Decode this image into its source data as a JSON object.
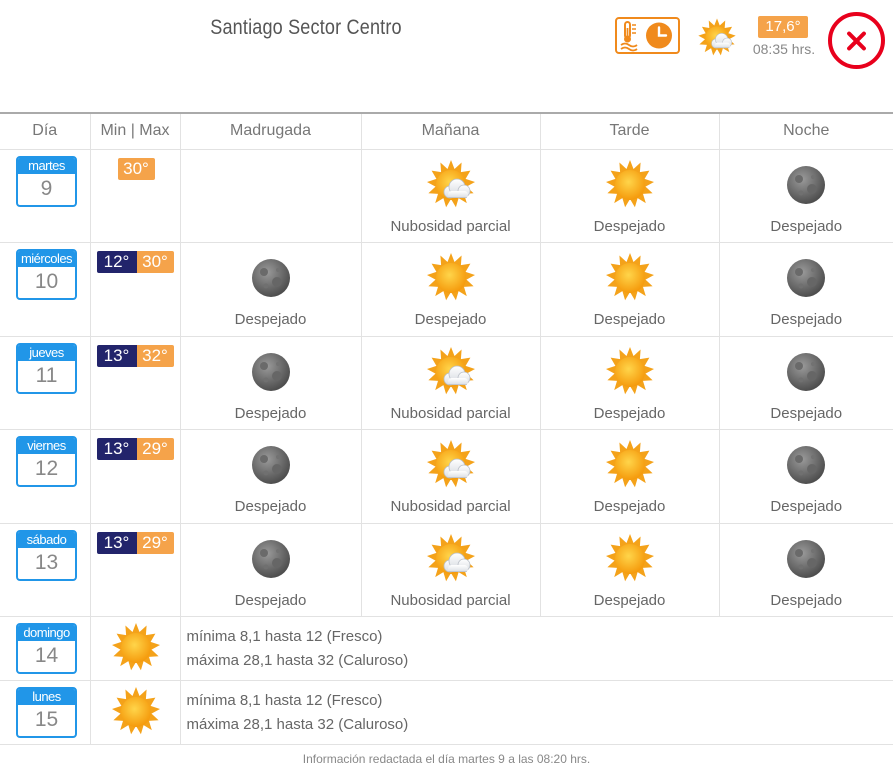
{
  "header": {
    "title": "Santiago Sector Centro",
    "current_temp": "17,6°",
    "current_time": "08:35 hrs.",
    "temp_clock_icon": "thermometer-clock-icon",
    "weather_icon": "partly-cloudy-icon",
    "close_icon": "close-icon"
  },
  "table": {
    "columns": [
      "Día",
      "Min | Max",
      "Madrugada",
      "Mañana",
      "Tarde",
      "Noche"
    ],
    "days": [
      {
        "name": "martes",
        "num": "9",
        "min": "",
        "max": "30°",
        "conds": [
          null,
          {
            "icon": "partly-cloudy-icon",
            "label": "Nubosidad parcial"
          },
          {
            "icon": "sun-icon",
            "label": "Despejado"
          },
          {
            "icon": "moon-icon",
            "label": "Despejado"
          }
        ]
      },
      {
        "name": "miércoles",
        "num": "10",
        "min": "12°",
        "max": "30°",
        "conds": [
          {
            "icon": "moon-icon",
            "label": "Despejado"
          },
          {
            "icon": "sun-icon",
            "label": "Despejado"
          },
          {
            "icon": "sun-icon",
            "label": "Despejado"
          },
          {
            "icon": "moon-icon",
            "label": "Despejado"
          }
        ]
      },
      {
        "name": "jueves",
        "num": "11",
        "min": "13°",
        "max": "32°",
        "conds": [
          {
            "icon": "moon-icon",
            "label": "Despejado"
          },
          {
            "icon": "partly-cloudy-icon",
            "label": "Nubosidad parcial"
          },
          {
            "icon": "sun-icon",
            "label": "Despejado"
          },
          {
            "icon": "moon-icon",
            "label": "Despejado"
          }
        ]
      },
      {
        "name": "viernes",
        "num": "12",
        "min": "13°",
        "max": "29°",
        "conds": [
          {
            "icon": "moon-icon",
            "label": "Despejado"
          },
          {
            "icon": "partly-cloudy-icon",
            "label": "Nubosidad parcial"
          },
          {
            "icon": "sun-icon",
            "label": "Despejado"
          },
          {
            "icon": "moon-icon",
            "label": "Despejado"
          }
        ]
      },
      {
        "name": "sábado",
        "num": "13",
        "min": "13°",
        "max": "29°",
        "conds": [
          {
            "icon": "moon-icon",
            "label": "Despejado"
          },
          {
            "icon": "partly-cloudy-icon",
            "label": "Nubosidad parcial"
          },
          {
            "icon": "sun-icon",
            "label": "Despejado"
          },
          {
            "icon": "moon-icon",
            "label": "Despejado"
          }
        ]
      }
    ],
    "summary_days": [
      {
        "name": "domingo",
        "num": "14",
        "icon": "sun-icon",
        "line1": "mínima 8,1 hasta 12 (Fresco)",
        "line2": "máxima 28,1 hasta 32 (Caluroso)"
      },
      {
        "name": "lunes",
        "num": "15",
        "icon": "sun-icon",
        "line1": "mínima 8,1 hasta 12 (Fresco)",
        "line2": "máxima 28,1 hasta 32 (Caluroso)"
      }
    ]
  },
  "footer": {
    "text": "Información redactada el día martes 9 a las 08:20 hrs."
  },
  "colors": {
    "calendar_blue": "#2196e8",
    "min_temp_bg": "#22246b",
    "max_temp_bg": "#f5a34a",
    "close_red": "#e8001c",
    "accent_orange": "#f08a1c"
  }
}
